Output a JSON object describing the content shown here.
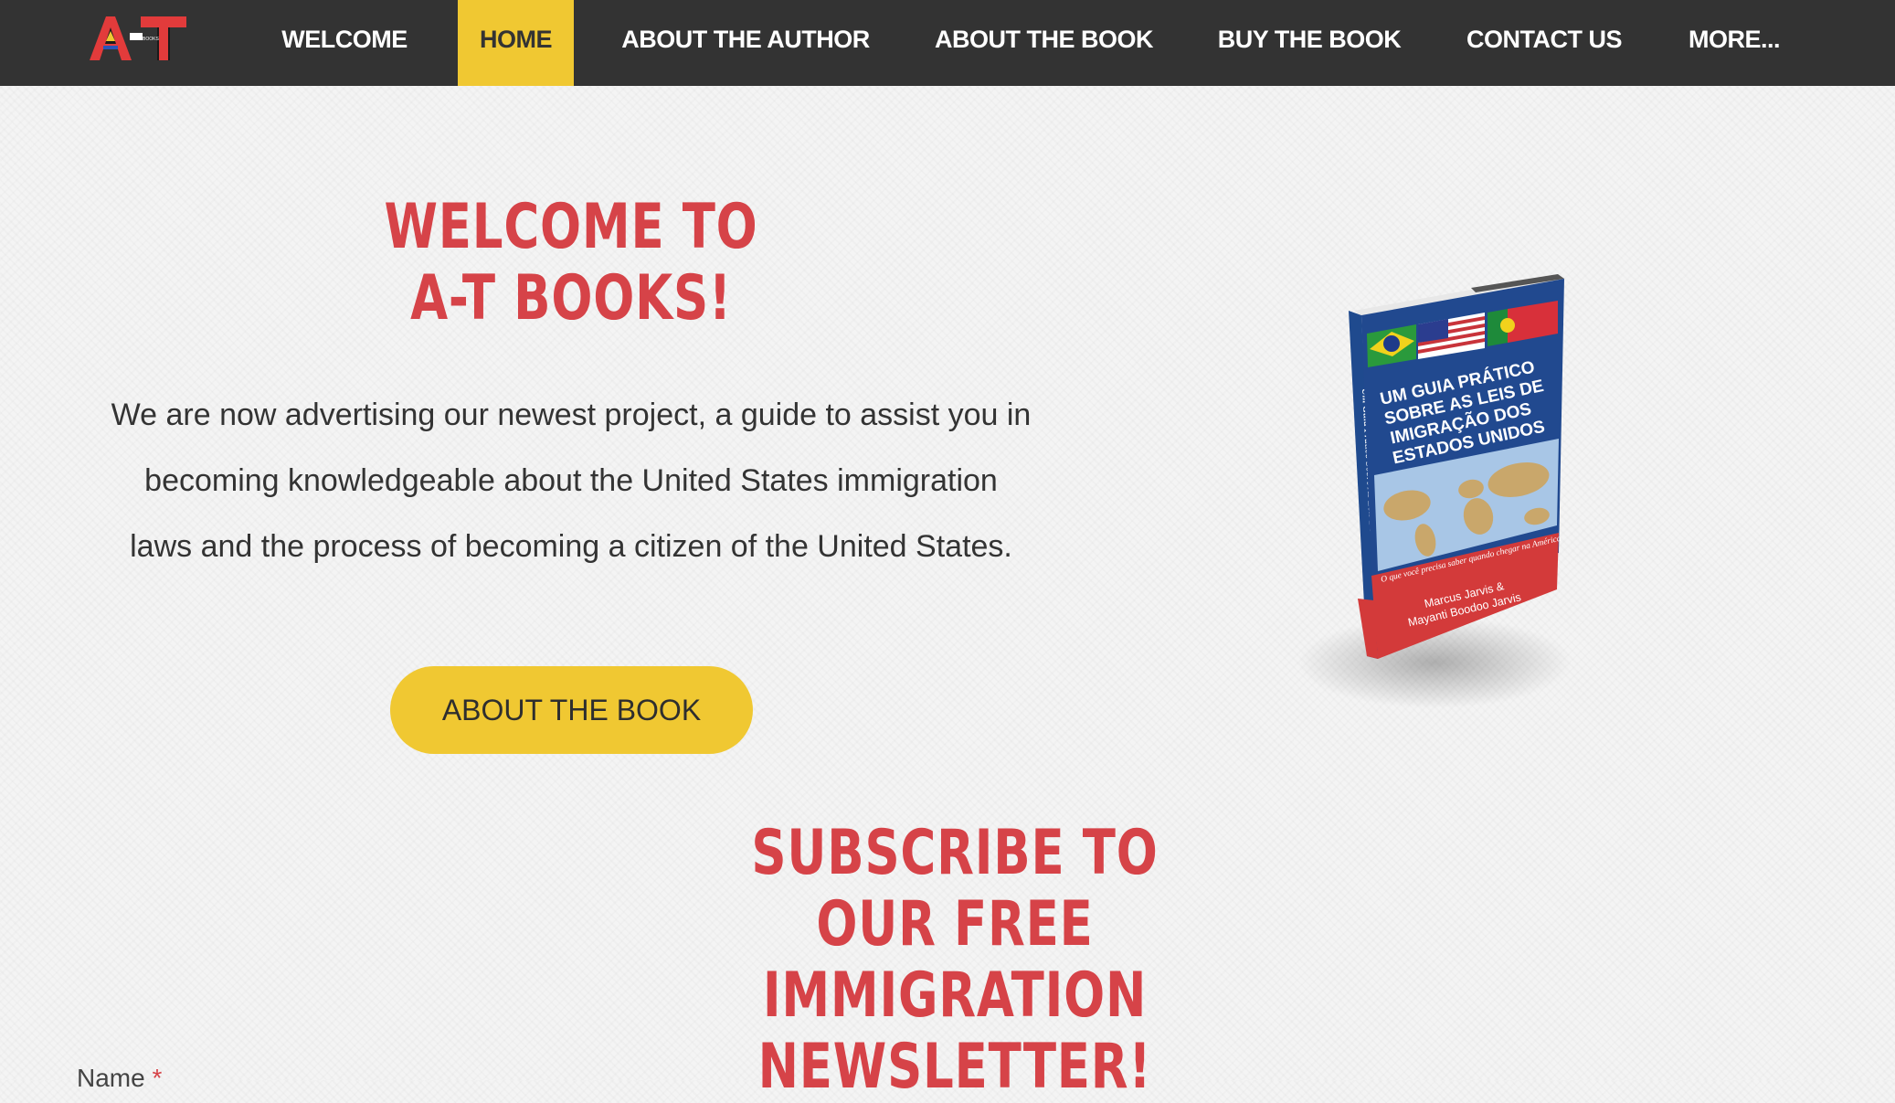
{
  "header": {
    "logo_text": "A-T",
    "logo_subtext": "BOOKS",
    "nav": [
      {
        "label": "WELCOME",
        "active": false
      },
      {
        "label": "HOME",
        "active": true
      },
      {
        "label": "ABOUT THE AUTHOR",
        "active": false
      },
      {
        "label": "ABOUT THE BOOK",
        "active": false
      },
      {
        "label": "BUY THE BOOK",
        "active": false
      },
      {
        "label": "CONTACT US",
        "active": false
      },
      {
        "label": "MORE...",
        "active": false
      }
    ]
  },
  "hero": {
    "title_line1": "WELCOME TO",
    "title_line2": "A-T BOOKS!",
    "intro_line1": "We are now advertising our newest project, a guide to assist you in",
    "intro_line2": "becoming knowledgeable about the United States immigration",
    "intro_line3": "laws and the process of becoming a citizen of the United States.",
    "cta_label": "ABOUT THE BOOK"
  },
  "book": {
    "title_line1": "UM GUIA PRÁTICO",
    "title_line2": "SOBRE AS LEIS DE",
    "title_line3": "IMIGRAÇÃO DOS",
    "title_line4": "ESTADOS UNIDOS",
    "tagline": "O que você precisa saber quando chegar na América",
    "author_line1": "Marcus Jarvis &",
    "author_line2": "Mayanti Boodoo Jarvis",
    "spine": "Um Guia Prático Sobre As Leis De"
  },
  "subscribe": {
    "title_line1": "SUBSCRIBE TO",
    "title_line2": "OUR FREE",
    "title_line3": "IMMIGRATION NEWSLETTER!",
    "name_label": "Name",
    "required_mark": "*"
  },
  "colors": {
    "nav_bg": "#333333",
    "accent_yellow": "#f0c832",
    "title_red": "#d64348",
    "text_dark": "#333333"
  }
}
